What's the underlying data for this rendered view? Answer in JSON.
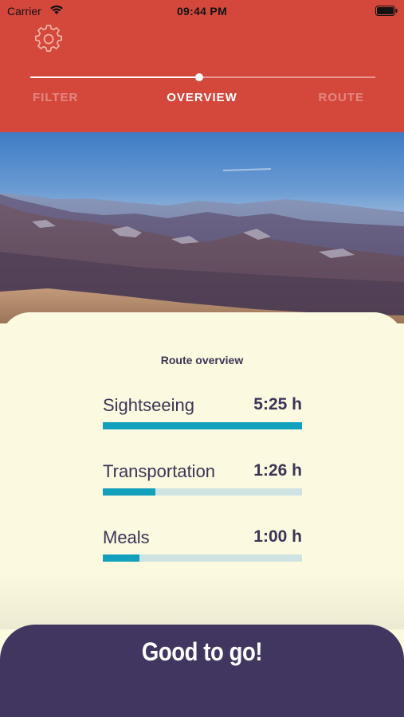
{
  "status_bar": {
    "carrier": "Carrier",
    "time": "09:44 PM"
  },
  "header": {
    "background_color": "#d4483c",
    "settings_icon": "gear-icon",
    "progress": 0.49,
    "steps": [
      {
        "label": "FILTER",
        "active": false
      },
      {
        "label": "OVERVIEW",
        "active": true
      },
      {
        "label": "ROUTE",
        "active": false
      }
    ]
  },
  "overview": {
    "title": "Route overview",
    "metrics": [
      {
        "label": "Sightseeing",
        "value": "5:25 h",
        "fraction": 1.0
      },
      {
        "label": "Transportation",
        "value": "1:26 h",
        "fraction": 0.265
      },
      {
        "label": "Meals",
        "value": "1:00 h",
        "fraction": 0.185
      }
    ],
    "bar_color": "#13a0bd",
    "bar_track_color": "#cfe3e3"
  },
  "action": {
    "label": "Good to go!",
    "background_color": "#413660"
  }
}
